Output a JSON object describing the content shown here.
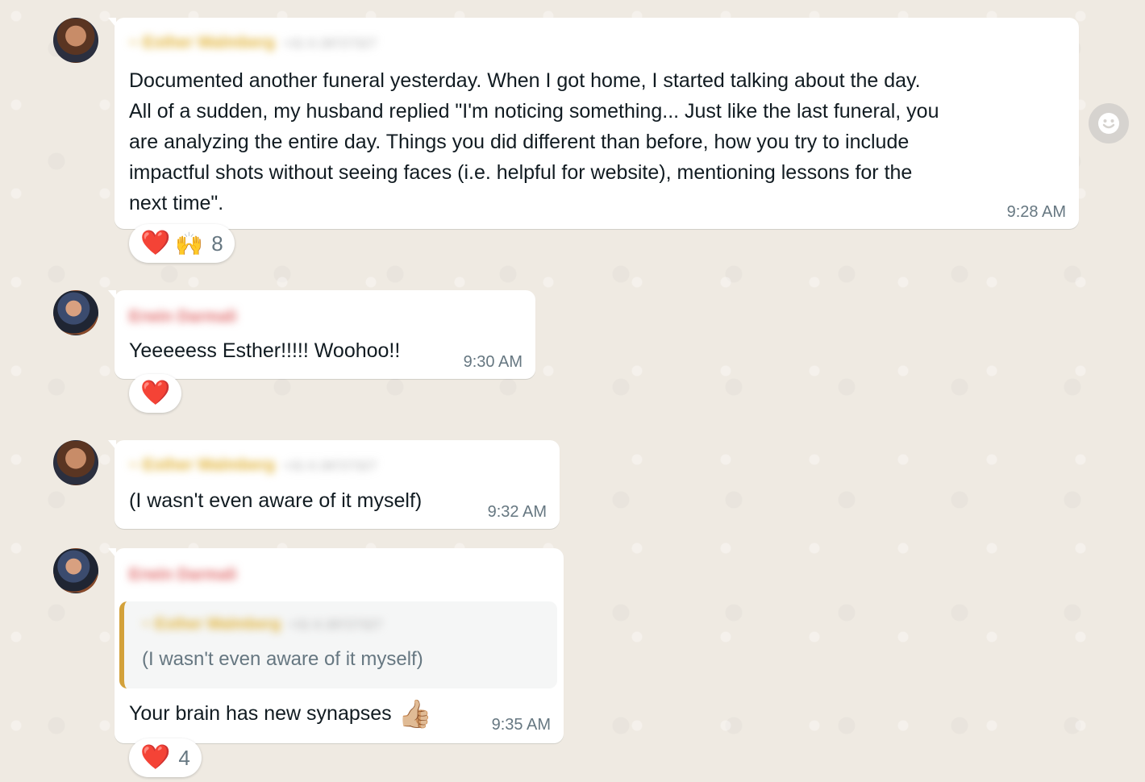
{
  "messages": [
    {
      "sender": "~ Esther Walmberg",
      "sender_phone": "+31 6 28727327",
      "text_lines": [
        "Documented another funeral yesterday. When I got home, I started talking about the day.",
        "All of a sudden, my husband replied \"I'm noticing something... Just like the last funeral, you",
        "are analyzing the entire day. Things you did different than before, how you try to include",
        "impactful shots without seeing faces (i.e. helpful for website), mentioning lessons for the",
        "next time\"."
      ],
      "time": "9:28 AM",
      "reactions": {
        "emojis": [
          "❤️",
          "🙌"
        ],
        "count": "8"
      }
    },
    {
      "sender": "Erwin Darmali",
      "text": "Yeeeeess Esther!!!!! Woohoo!!",
      "time": "9:30 AM",
      "reactions": {
        "emojis": [
          "❤️"
        ],
        "count": ""
      }
    },
    {
      "sender": "~ Esther Walmberg",
      "sender_phone": "+31 6 28727327",
      "text": "(I wasn't even aware of it myself)",
      "time": "9:32 AM"
    },
    {
      "sender": "Erwin Darmali",
      "quote": {
        "sender": "~ Esther Walmberg",
        "sender_phone": "+31 6 28727327",
        "text": "(I wasn't even aware of it myself)"
      },
      "text": "Your brain has new synapses",
      "emoji": "👍🏼",
      "time": "9:35 AM",
      "reactions": {
        "emojis": [
          "❤️"
        ],
        "count": "4"
      }
    }
  ],
  "icons": {
    "emoji_picker": "smiley-icon"
  },
  "colors": {
    "background": "#efeae2",
    "bubble": "#ffffff",
    "quote_bar": "#d3a13a",
    "time": "#667781"
  }
}
